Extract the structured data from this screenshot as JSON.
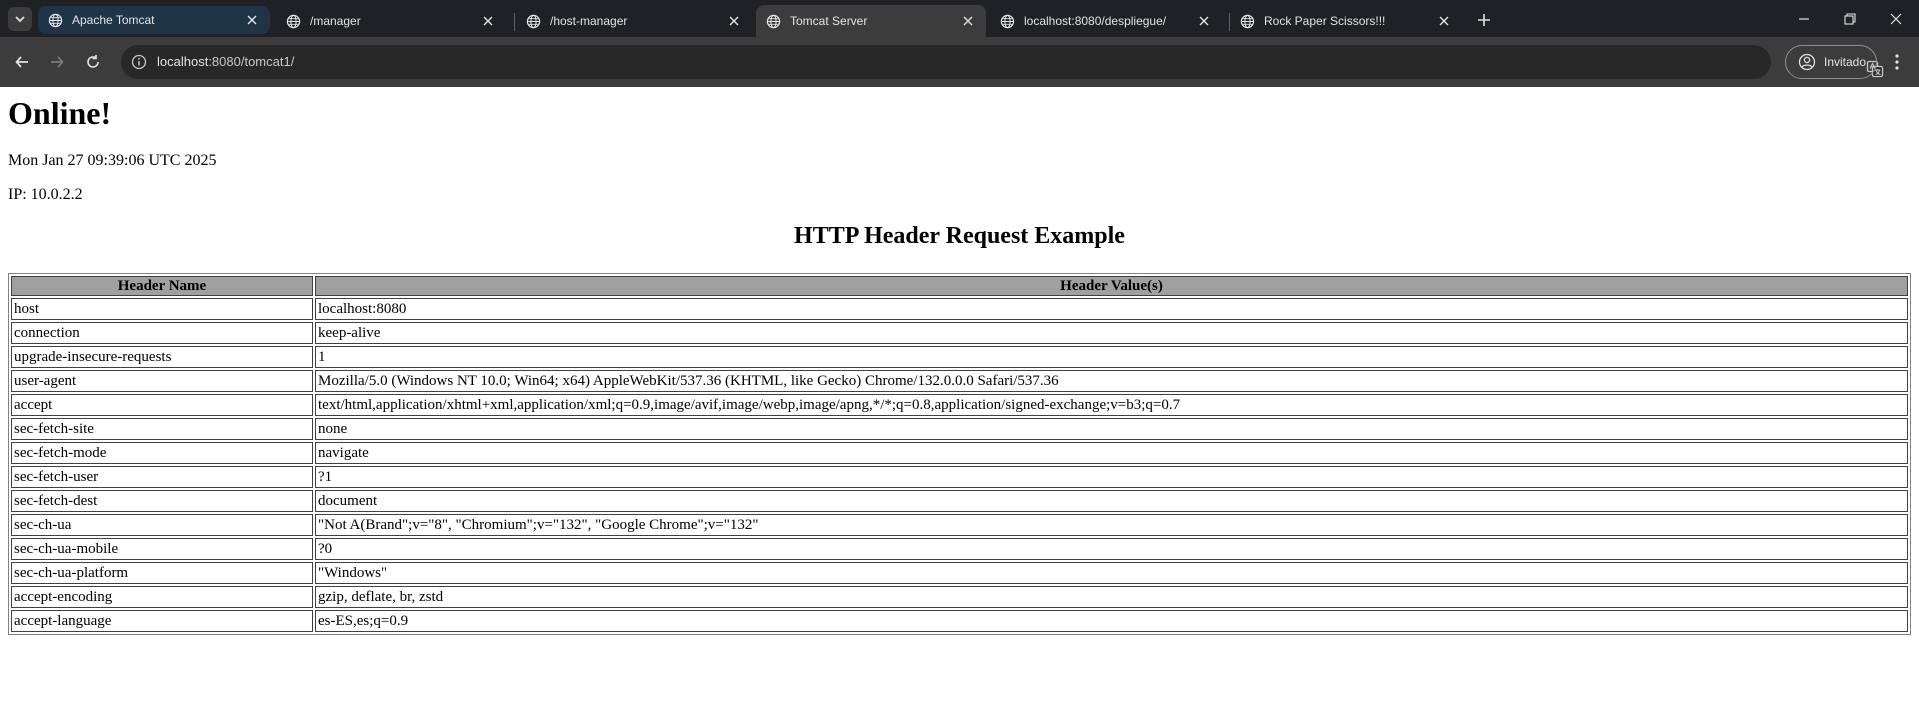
{
  "browser": {
    "tabs": [
      {
        "title": "Apache Tomcat",
        "state": "highlighted"
      },
      {
        "title": "/manager",
        "state": "normal"
      },
      {
        "title": "/host-manager",
        "state": "normal"
      },
      {
        "title": "Tomcat Server",
        "state": "active"
      },
      {
        "title": "localhost:8080/despliegue/",
        "state": "normal"
      },
      {
        "title": "Rock Paper Scissors!!!",
        "state": "normal"
      }
    ],
    "url_host": "localhost",
    "url_rest": ":8080/tomcat1/",
    "profile_label": "Invitado",
    "colors": {
      "tabstrip": "#202124",
      "toolbar": "#3c3c3c",
      "omnibox": "#282828",
      "highlight_tab": "#1f3447"
    }
  },
  "page": {
    "heading": "Online!",
    "date": "Mon Jan 27 09:39:06 UTC 2025",
    "ip": "IP: 10.0.2.2",
    "section_title": "HTTP Header Request Example",
    "table": {
      "columns": [
        "Header Name",
        "Header Value(s)"
      ],
      "rows": [
        [
          "host",
          "localhost:8080"
        ],
        [
          "connection",
          "keep-alive"
        ],
        [
          "upgrade-insecure-requests",
          "1"
        ],
        [
          "user-agent",
          "Mozilla/5.0 (Windows NT 10.0; Win64; x64) AppleWebKit/537.36 (KHTML, like Gecko) Chrome/132.0.0.0 Safari/537.36"
        ],
        [
          "accept",
          "text/html,application/xhtml+xml,application/xml;q=0.9,image/avif,image/webp,image/apng,*/*;q=0.8,application/signed-exchange;v=b3;q=0.7"
        ],
        [
          "sec-fetch-site",
          "none"
        ],
        [
          "sec-fetch-mode",
          "navigate"
        ],
        [
          "sec-fetch-user",
          "?1"
        ],
        [
          "sec-fetch-dest",
          "document"
        ],
        [
          "sec-ch-ua",
          "\"Not A(Brand\";v=\"8\", \"Chromium\";v=\"132\", \"Google Chrome\";v=\"132\""
        ],
        [
          "sec-ch-ua-mobile",
          "?0"
        ],
        [
          "sec-ch-ua-platform",
          "\"Windows\""
        ],
        [
          "accept-encoding",
          "gzip, deflate, br, zstd"
        ],
        [
          "accept-language",
          "es-ES,es;q=0.9"
        ]
      ]
    }
  }
}
